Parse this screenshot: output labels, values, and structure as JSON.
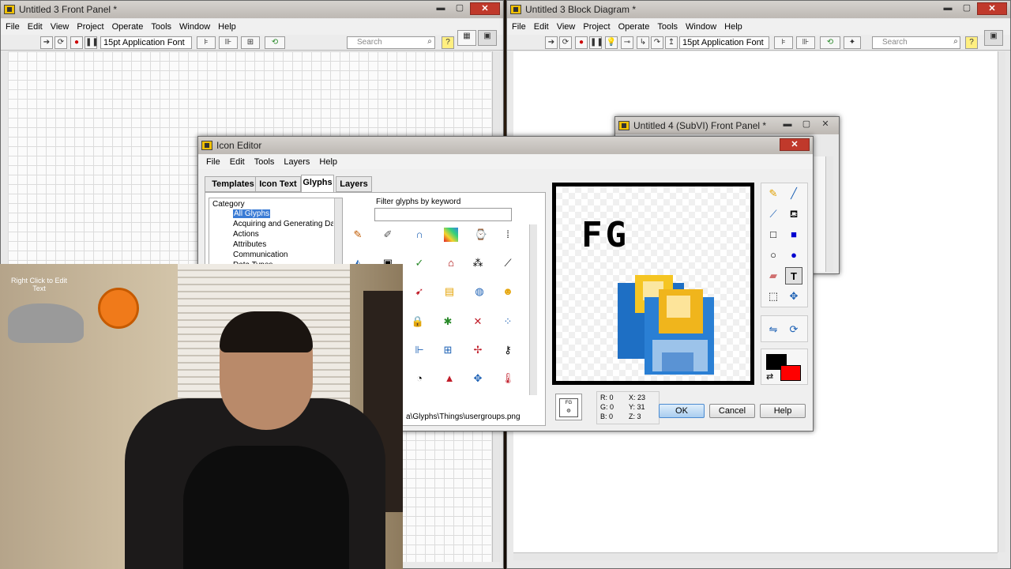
{
  "front_panel": {
    "title": "Untitled 3 Front Panel *",
    "menu": [
      "File",
      "Edit",
      "View",
      "Project",
      "Operate",
      "Tools",
      "Window",
      "Help"
    ],
    "font": "15pt Application Font",
    "search_placeholder": "Search"
  },
  "block_diagram": {
    "title": "Untitled 3 Block Diagram *",
    "menu": [
      "File",
      "Edit",
      "View",
      "Project",
      "Operate",
      "Tools",
      "Window",
      "Help"
    ],
    "font": "15pt Application Font",
    "search_placeholder": "Search"
  },
  "subvi": {
    "title": "Untitled 4 (SubVI) Front Panel *"
  },
  "icon_editor": {
    "title": "Icon Editor",
    "menu": [
      "File",
      "Edit",
      "Tools",
      "Layers",
      "Help"
    ],
    "tabs": [
      "Templates",
      "Icon Text",
      "Glyphs",
      "Layers"
    ],
    "active_tab": "Glyphs",
    "category_header": "Category",
    "categories": [
      "All Glyphs",
      "Acquiring and Generating Dat",
      "Actions",
      "Attributes",
      "Communication",
      "Data Types"
    ],
    "selected_category": "All Glyphs",
    "filter_label": "Filter glyphs by keyword",
    "filter_value": "",
    "glyph_path": "a\\Glyphs\\Things\\usergroups.png",
    "icon_text": "FG",
    "status": {
      "r": "R: 0",
      "g": "G: 0",
      "b": "B: 0",
      "x": "X: 23",
      "y": "Y: 31",
      "z": "Z: 3"
    },
    "buttons": {
      "ok": "OK",
      "cancel": "Cancel",
      "help": "Help"
    },
    "colors": {
      "foreground": "#000000",
      "background": "#ff0000"
    }
  },
  "webcam": {
    "overlay_text_line1": "Right Click to Edit",
    "overlay_text_line2": "Text"
  }
}
